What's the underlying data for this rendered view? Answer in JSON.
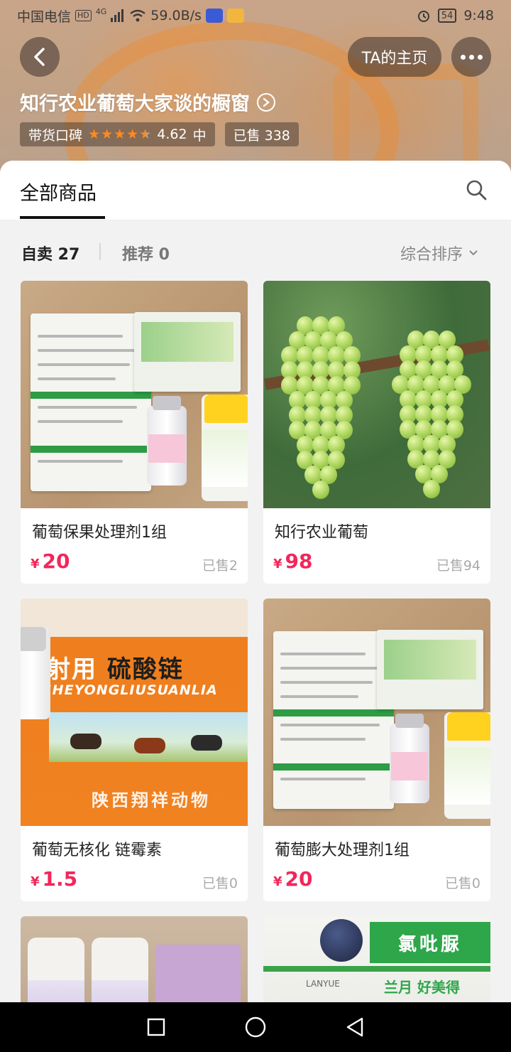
{
  "status_bar": {
    "carrier": "中国电信",
    "hd": "HD",
    "network": "4G",
    "speed": "59.0B/s",
    "battery": "54",
    "time": "9:48"
  },
  "header": {
    "back_icon": "chevron-left-icon",
    "home_button": "TA的主页",
    "more_icon": "more-dots-icon",
    "shop_title": "知行农业葡萄大家谈的橱窗",
    "reputation_label": "带货口碑",
    "rating": "4.62",
    "rating_level": "中",
    "rating_stars": 4.5,
    "sold_label": "已售 338",
    "star_color": "#ff8a1f"
  },
  "tabs": {
    "all_products": "全部商品",
    "search_icon": "search-icon"
  },
  "filters": {
    "self_sell": "自卖 27",
    "recommend": "推荐 0",
    "sort": "综合排序",
    "sort_icon": "chevron-down-icon"
  },
  "products": [
    {
      "name": "葡萄保果处理剂1组",
      "currency": "¥",
      "price": "20",
      "sold": "已售2"
    },
    {
      "name": "知行农业葡萄",
      "currency": "¥",
      "price": "98",
      "sold": "已售94"
    },
    {
      "name": "葡萄无核化 链霉素",
      "currency": "¥",
      "price": "1.5",
      "sold": "已售0"
    },
    {
      "name": "葡萄膨大处理剂1组",
      "currency": "¥",
      "price": "20",
      "sold": "已售0"
    }
  ],
  "image_text": {
    "box_line1_a": "射用",
    "box_line1_b": "硫酸链",
    "box_pinyin": "SHEYONGLIUSUANLIA",
    "box_bottom": "陕西翔祥动物",
    "chlor_tag": "氯吡脲",
    "chlor_brand": "兰月 好美得",
    "chlor_lanyue": "LANYUE"
  },
  "nav": {
    "recent": "square-icon",
    "home": "circle-icon",
    "back": "triangle-back-icon"
  },
  "colors": {
    "price": "#f2275a",
    "accent_star": "#ff8a1f"
  }
}
